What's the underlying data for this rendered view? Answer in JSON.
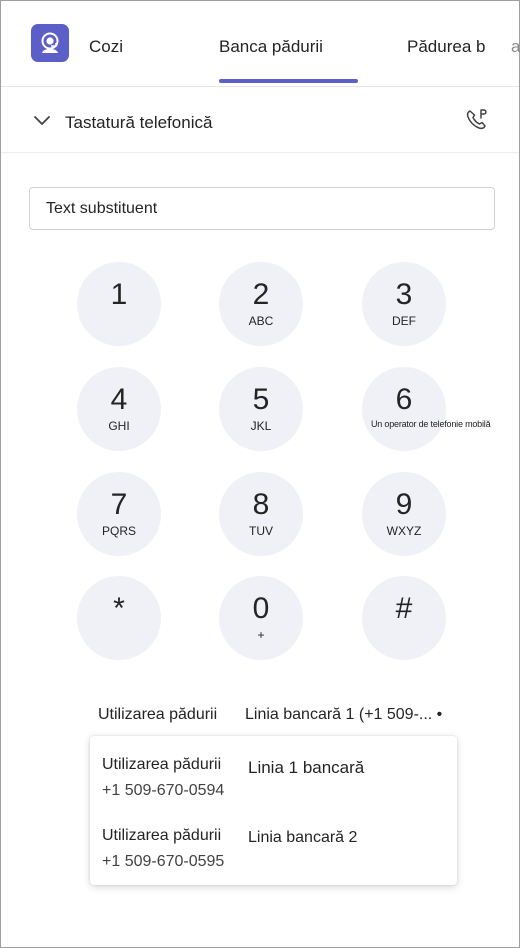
{
  "app": {
    "name": "Cozi",
    "icon": "headset-person-icon",
    "accent": "#5b5fc7"
  },
  "tabs": [
    {
      "label": "Banca pădurii",
      "selected": true
    },
    {
      "label": "Pădurea b",
      "selected": false
    }
  ],
  "tabs_overflow": "a",
  "section": {
    "title": "Tastatură telefonică",
    "expand_icon": "chevron-down-icon",
    "action_icon": "call-park-icon"
  },
  "input": {
    "placeholder": "Text substituent",
    "value": ""
  },
  "dialpad": [
    {
      "digit": "1",
      "letters": ""
    },
    {
      "digit": "2",
      "letters": "ABC"
    },
    {
      "digit": "3",
      "letters": "DEF"
    },
    {
      "digit": "4",
      "letters": "GHI"
    },
    {
      "digit": "5",
      "letters": "JKL"
    },
    {
      "digit": "6",
      "letters": "Un operator de telefonie mobilă"
    },
    {
      "digit": "7",
      "letters": "PQRS"
    },
    {
      "digit": "8",
      "letters": "TUV"
    },
    {
      "digit": "9",
      "letters": "WXYZ"
    },
    {
      "digit": "*",
      "letters": ""
    },
    {
      "digit": "0",
      "letters": "+"
    },
    {
      "digit": "#",
      "letters": ""
    }
  ],
  "line_select": {
    "label": "Utilizarea pădurii",
    "value": "Linia bancară 1 (+1 509-... •"
  },
  "line_options": [
    {
      "name": "Utilizarea pădurii",
      "number": "+1 509-670-0594",
      "line": "Linia 1 bancară"
    },
    {
      "name": "Utilizarea pădurii",
      "number": "+1 509-670-0595",
      "line": "Linia bancară 2"
    }
  ]
}
